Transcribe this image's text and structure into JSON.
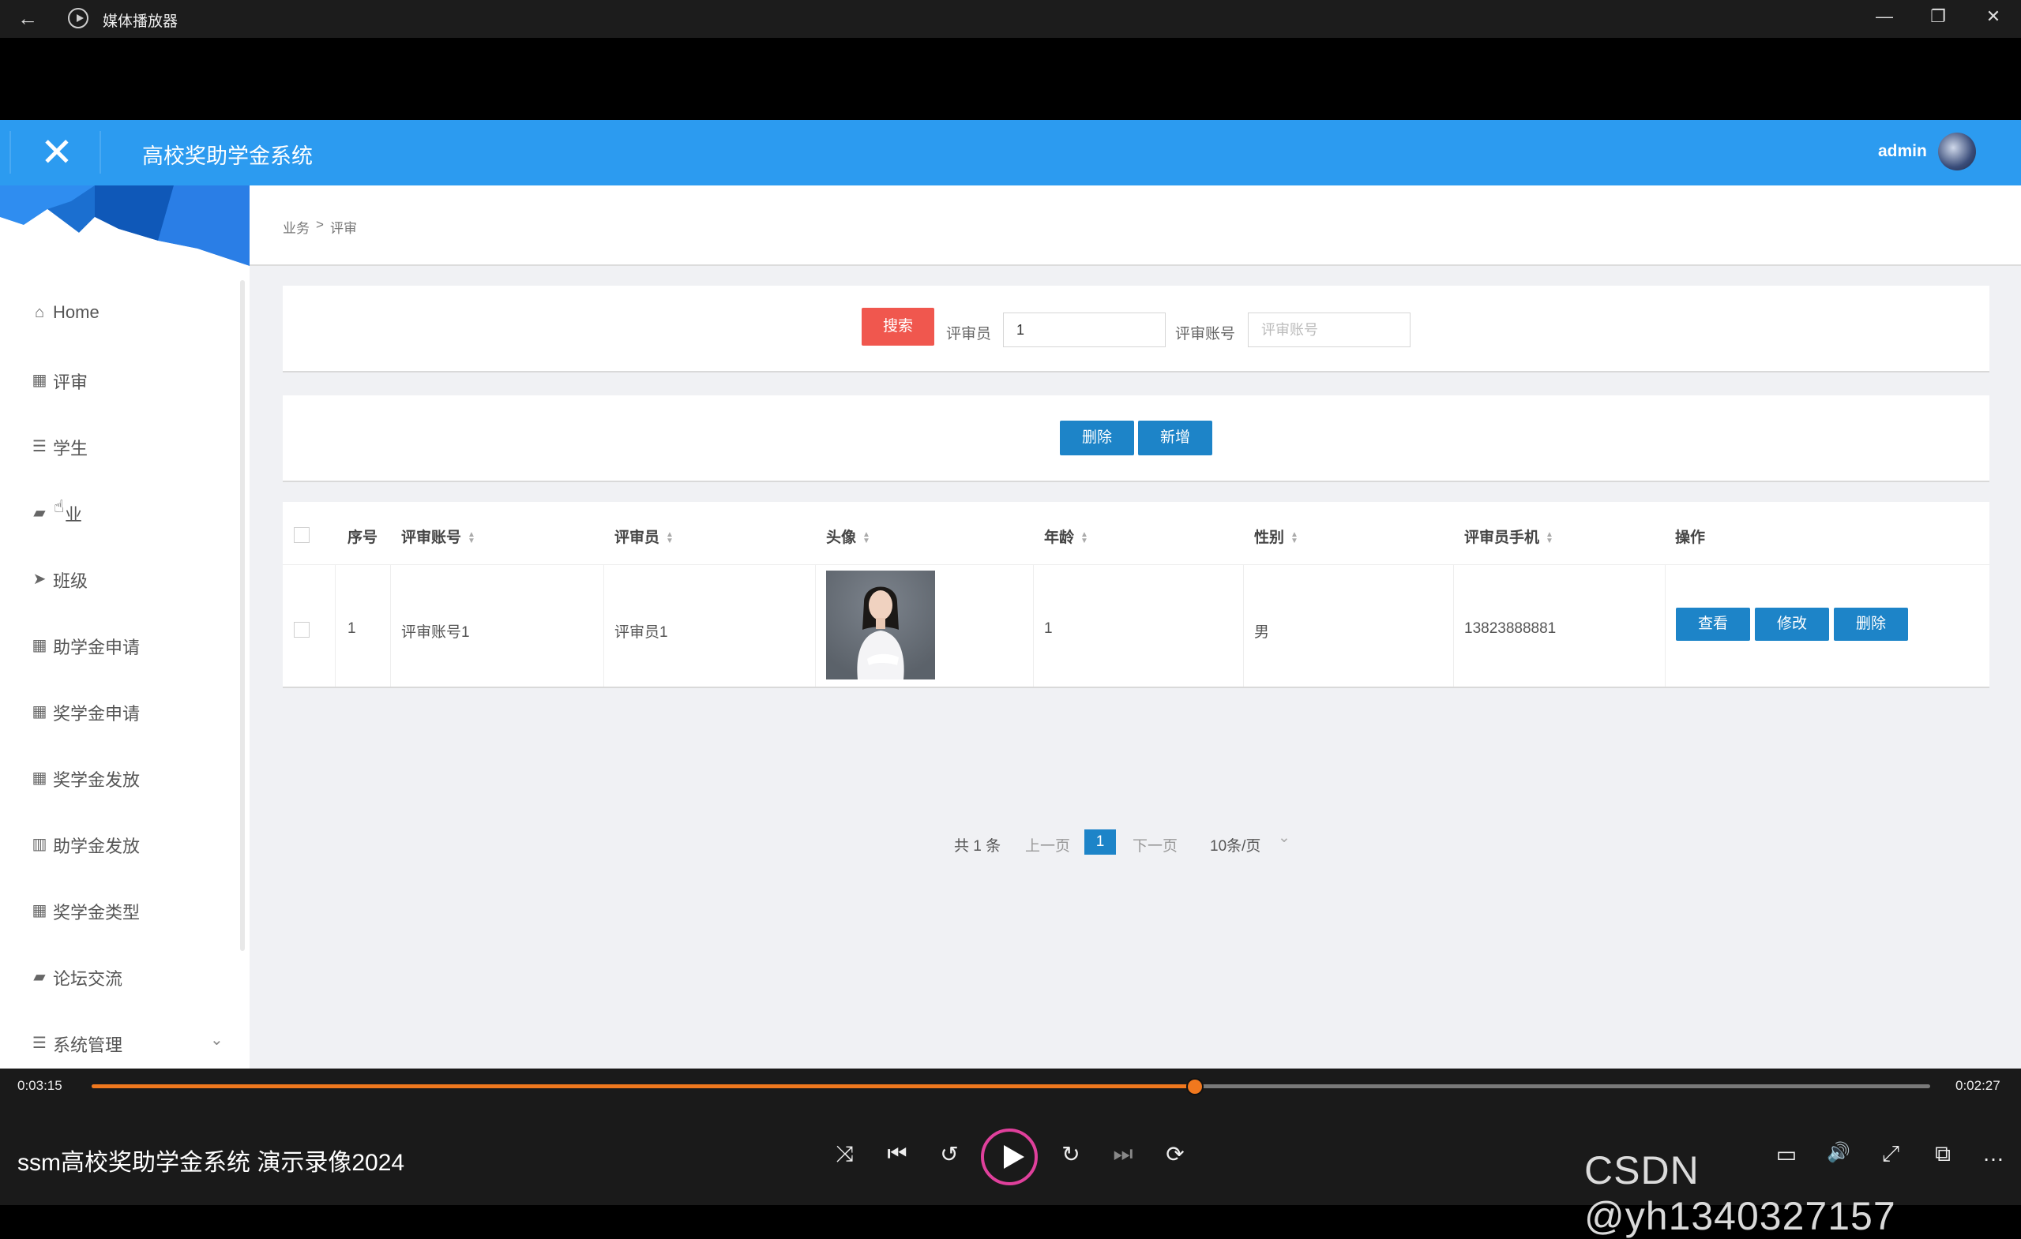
{
  "window": {
    "app_title": "媒体播放器",
    "back_icon": "back-arrow-icon",
    "minimize": "—",
    "restore": "❐",
    "close": "✕"
  },
  "header": {
    "close_glyph": "✕",
    "system_title": "高校奖助学金系统",
    "username": "admin",
    "brand_color": "#2c9bf0"
  },
  "sidebar": {
    "items": [
      {
        "label": "Home",
        "icon": "home-icon",
        "glyph": "⌂"
      },
      {
        "label": "评审",
        "icon": "grid-icon",
        "glyph": "▦"
      },
      {
        "label": "学生",
        "icon": "list-icon",
        "glyph": "☰"
      },
      {
        "label": "业",
        "icon": "briefcase-icon",
        "glyph": "▰"
      },
      {
        "label": "班级",
        "icon": "send-icon",
        "glyph": "➤"
      },
      {
        "label": "助学金申请",
        "icon": "grid-icon",
        "glyph": "▦"
      },
      {
        "label": "奖学金申请",
        "icon": "grid-icon",
        "glyph": "▦"
      },
      {
        "label": "奖学金发放",
        "icon": "grid-icon",
        "glyph": "▦"
      },
      {
        "label": "助学金发放",
        "icon": "bars-icon",
        "glyph": "▥"
      },
      {
        "label": "奖学金类型",
        "icon": "grid-icon",
        "glyph": "▦"
      },
      {
        "label": "论坛交流",
        "icon": "briefcase-icon",
        "glyph": "▰"
      },
      {
        "label": "系统管理",
        "icon": "list-icon",
        "glyph": "☰",
        "chevron": "⌄"
      }
    ]
  },
  "breadcrumb": {
    "parent": "业务",
    "separator": ">",
    "current": "评审"
  },
  "search": {
    "button": "搜索",
    "field1_label": "评审员",
    "field1_value": "1",
    "field2_label": "评审账号",
    "field2_placeholder": "评审账号"
  },
  "actions": {
    "delete": "删除",
    "add": "新增"
  },
  "table": {
    "headers": [
      "序号",
      "评审账号",
      "评审员",
      "头像",
      "年龄",
      "性别",
      "评审员手机",
      "操作"
    ],
    "sort_glyph_up": "▲",
    "sort_glyph_down": "▼",
    "rows": [
      {
        "index": "1",
        "account": "评审账号1",
        "name": "评审员1",
        "age": "1",
        "gender": "男",
        "phone": "13823888881",
        "buttons": [
          "查看",
          "修改",
          "删除"
        ]
      }
    ]
  },
  "pagination": {
    "total": "共 1 条",
    "prev": "上一页",
    "page": "1",
    "next": "下一页",
    "page_size": "10条/页",
    "dropdown": "⌄"
  },
  "player": {
    "elapsed": "0:03:15",
    "remaining": "0:02:27",
    "progress": 0.6,
    "title": "ssm高校奖助学金系统 演示录像2024",
    "watermark": "CSDN @yh1340327157",
    "controls": {
      "shuffle": "⤨",
      "previous": "⏮",
      "rewind": "↺",
      "forward": "↻",
      "next": "⏭",
      "repeat": "⟳",
      "captions": "▭",
      "volume": "🔊",
      "fullscreen": "⤢",
      "miniplayer": "⧉",
      "more": "…"
    },
    "accent_color": "#f0781e"
  }
}
